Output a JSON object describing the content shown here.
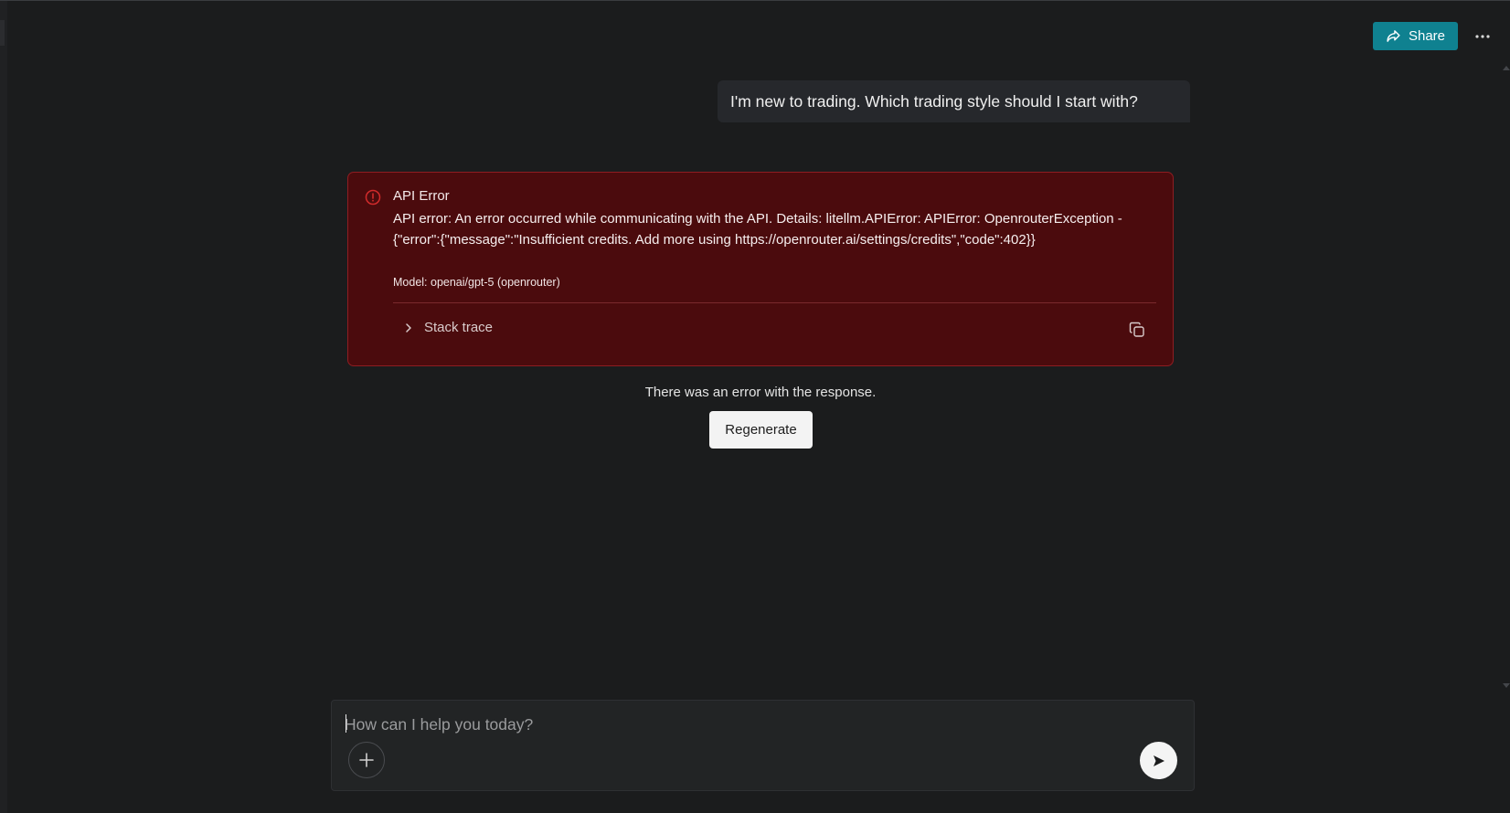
{
  "header": {
    "share_label": "Share",
    "share_icon": "share-arrow-icon",
    "more_icon": "more-horizontal-icon"
  },
  "conversation": {
    "user_message": "I'm new to trading. Which trading style should I start with?",
    "error": {
      "title": "API Error",
      "details": "API error: An error occurred while communicating with the API. Details: litellm.APIError: APIError: OpenrouterException - {\"error\":{\"message\":\"Insufficient credits. Add more using https://openrouter.ai/settings/credits\",\"code\":402}}",
      "model": "Model: openai/gpt-5 (openrouter)",
      "stack_trace_label": "Stack trace",
      "icon": "alert-circle-icon",
      "copy_icon": "copy-icon"
    },
    "status_text": "There was an error with the response.",
    "regenerate_label": "Regenerate"
  },
  "composer": {
    "placeholder": "How can I help you today?",
    "value": "",
    "attach_icon": "plus-icon",
    "send_icon": "send-arrow-icon"
  },
  "colors": {
    "background": "#1b1c1d",
    "accent": "#0f8190",
    "error_background": "#4b0b0d",
    "error_border": "#8f1d22",
    "error_icon": "#d12b2b"
  }
}
